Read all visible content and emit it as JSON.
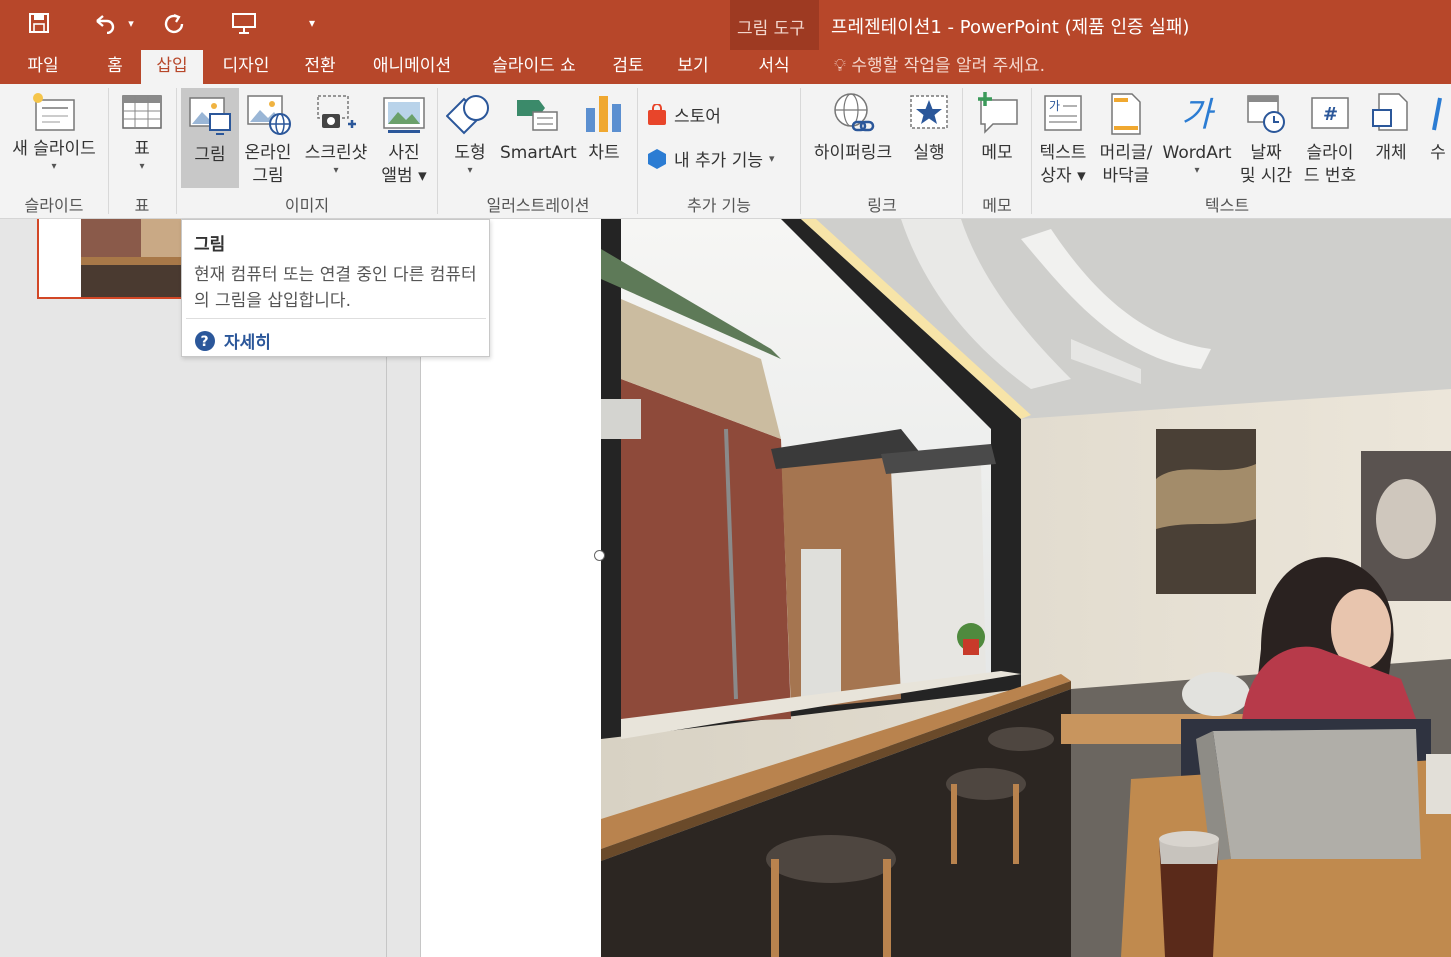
{
  "quick_access": {
    "save_icon": "save-icon",
    "undo_icon": "undo-icon",
    "undo_dropdown": "▾",
    "redo_icon": "redo-icon",
    "present_icon": "present-from-start-icon",
    "customize_icon": "▾"
  },
  "context": {
    "tools_title": "그림 도구",
    "tools_tab": "서식"
  },
  "window_title": "프레젠테이션1 - PowerPoint (제품 인증 실패)",
  "tabs": [
    "파일",
    "홈",
    "삽입",
    "디자인",
    "전환",
    "애니메이션",
    "슬라이드 쇼",
    "검토",
    "보기"
  ],
  "active_tab": "삽입",
  "tell_me": "수행할 작업을 알려 주세요.",
  "ribbon": {
    "new_slide": {
      "line1": "새 슬라이드",
      "caret": "▾"
    },
    "table": {
      "line1": "표",
      "caret": "▾"
    },
    "picture": {
      "line1": "그림"
    },
    "online_picture": {
      "line1": "온라인",
      "line2": "그림"
    },
    "screenshot": {
      "line1": "스크린샷",
      "caret": "▾"
    },
    "photo_album": {
      "line1": "사진",
      "line2": "앨범 ▾"
    },
    "shapes": {
      "line1": "도형",
      "caret": "▾"
    },
    "smartart": {
      "line1": "SmartArt"
    },
    "chart": {
      "line1": "차트"
    },
    "store": {
      "label": "스토어"
    },
    "my_addins": {
      "label": "내 추가 기능",
      "caret": "▾"
    },
    "hyperlink": {
      "line1": "하이퍼링크"
    },
    "action": {
      "line1": "실행"
    },
    "comment": {
      "line1": "메모"
    },
    "textbox": {
      "line1": "텍스트",
      "line2": "상자 ▾"
    },
    "header_footer": {
      "line1": "머리글/",
      "line2": "바닥글"
    },
    "wordart": {
      "line1": "WordArt",
      "caret": "▾"
    },
    "date_time": {
      "line1": "날짜",
      "line2": "및 시간"
    },
    "slide_number": {
      "line1": "슬라이",
      "line2": "드 번호"
    },
    "object": {
      "line1": "개체"
    },
    "partial": {
      "line1": "수"
    },
    "groups": {
      "slides": "슬라이드",
      "tables": "표",
      "images": "이미지",
      "illustrations": "일러스트레이션",
      "addins": "추가 기능",
      "links": "링크",
      "comments": "메모",
      "text": "텍스트"
    }
  },
  "tooltip": {
    "title": "그림",
    "body": "현재 컴퓨터 또는 연결 중인 다른 컴퓨터의 그림을 삽입합니다.",
    "help_icon": "help-icon",
    "help_link": "자세히"
  },
  "colors": {
    "accent": "#b7472a",
    "context_band": "#9e3a22",
    "ribbon_bg": "#f3f3f3",
    "selected_thumb_border": "#d24726",
    "help_link": "#2b579a"
  }
}
